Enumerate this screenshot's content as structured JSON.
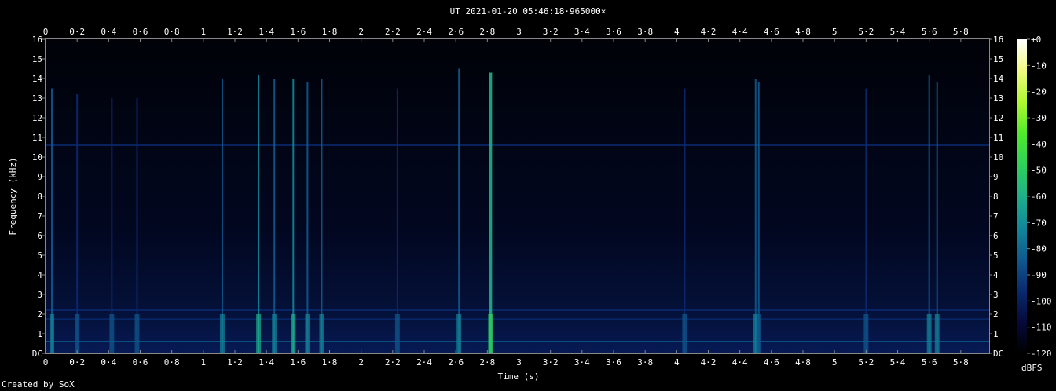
{
  "chart_data": {
    "type": "heatmap",
    "title": "UT 2021-01-20 05:46:18·965000×",
    "xlabel": "Time (s)",
    "ylabel": "Frequency (kHz)",
    "xlim": [
      0,
      5.98
    ],
    "ylim": [
      0,
      16
    ],
    "x_ticks": [
      "0",
      "0·2",
      "0·4",
      "0·6",
      "0·8",
      "1",
      "1·2",
      "1·4",
      "1·6",
      "1·8",
      "2",
      "2·2",
      "2·4",
      "2·6",
      "2·8",
      "3",
      "3·2",
      "3·4",
      "3·6",
      "3·8",
      "4",
      "4·2",
      "4·4",
      "4·6",
      "4·8",
      "5",
      "5·2",
      "5·4",
      "5·6",
      "5·8"
    ],
    "y_ticks": [
      "DC",
      "1",
      "2",
      "3",
      "4",
      "5",
      "6",
      "7",
      "8",
      "9",
      "10",
      "11",
      "12",
      "13",
      "14",
      "15",
      "16"
    ],
    "colorbar": {
      "label": "dBFS",
      "range": [
        -120,
        0
      ],
      "ticks": [
        "+0",
        "-10",
        "-20",
        "-30",
        "-40",
        "-50",
        "-60",
        "-70",
        "-80",
        "-90",
        "-100",
        "-110",
        "-120"
      ],
      "colors": [
        "#000000",
        "#050a3a",
        "#0a2a70",
        "#0f5a8f",
        "#12879a",
        "#1fb08a",
        "#2dd25a",
        "#50ea2a",
        "#b0f830",
        "#f0fa80",
        "#ffffff"
      ]
    },
    "events": [
      {
        "t": 0.04,
        "fmax": 13.5,
        "level": -85
      },
      {
        "t": 0.2,
        "fmax": 13.2,
        "level": -95
      },
      {
        "t": 0.42,
        "fmax": 13.0,
        "level": -95
      },
      {
        "t": 0.58,
        "fmax": 13.0,
        "level": -98
      },
      {
        "t": 1.12,
        "fmax": 14.0,
        "level": -88
      },
      {
        "t": 1.35,
        "fmax": 14.2,
        "level": -72
      },
      {
        "t": 1.45,
        "fmax": 14.0,
        "level": -80
      },
      {
        "t": 1.57,
        "fmax": 14.0,
        "level": -75
      },
      {
        "t": 1.66,
        "fmax": 13.8,
        "level": -80
      },
      {
        "t": 1.75,
        "fmax": 14.0,
        "level": -82
      },
      {
        "t": 2.23,
        "fmax": 13.5,
        "level": -92
      },
      {
        "t": 2.62,
        "fmax": 14.5,
        "level": -80
      },
      {
        "t": 2.82,
        "fmax": 14.3,
        "level": -55
      },
      {
        "t": 4.05,
        "fmax": 13.5,
        "level": -92
      },
      {
        "t": 4.5,
        "fmax": 14.0,
        "level": -88
      },
      {
        "t": 4.52,
        "fmax": 13.8,
        "level": -90
      },
      {
        "t": 5.2,
        "fmax": 13.5,
        "level": -95
      },
      {
        "t": 5.6,
        "fmax": 14.2,
        "level": -82
      },
      {
        "t": 5.65,
        "fmax": 13.8,
        "level": -85
      }
    ],
    "tones": [
      {
        "f": 10.6,
        "level": -95
      },
      {
        "f": 0.6,
        "level": -88
      },
      {
        "f": 1.75,
        "level": -96
      },
      {
        "f": 2.2,
        "level": -98
      }
    ]
  }
}
